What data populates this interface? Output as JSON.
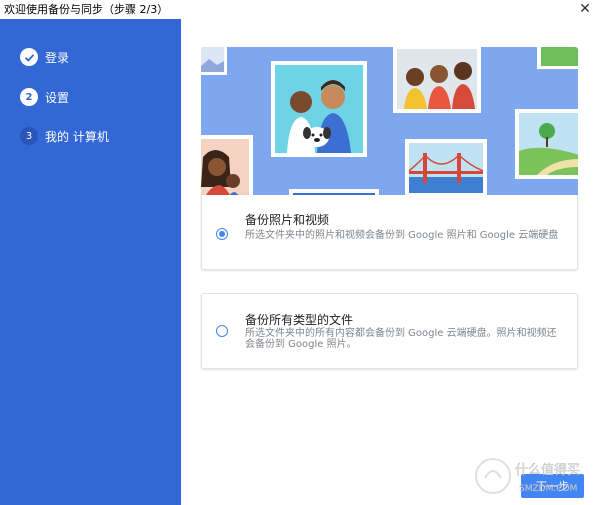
{
  "window": {
    "title": "欢迎使用备份与同步（步骤 2/3）",
    "close_icon": "close-icon"
  },
  "sidebar": {
    "steps": [
      {
        "number": "",
        "label": "登录",
        "state": "done",
        "icon": "check-icon"
      },
      {
        "number": "2",
        "label": "设置",
        "state": "current"
      },
      {
        "number": "3",
        "label": "我的 计算机",
        "state": "pending"
      }
    ]
  },
  "options": [
    {
      "title": "备份照片和视频",
      "description": "所选文件夹中的照片和视频会备份到 Google 照片和 Google 云端硬盘",
      "selected": true
    },
    {
      "title": "备份所有类型的文件",
      "description": "所选文件夹中的所有内容都会备份到 Google 云端硬盘。照片和视频还会备份到 Google 照片。",
      "selected": false
    }
  ],
  "footer": {
    "next_label": "下一步"
  },
  "watermark": {
    "text": "什么值得买",
    "site": "SMZDM.COM"
  },
  "colors": {
    "sidebar": "#3367d6",
    "accent": "#4285f4",
    "hero_bg": "#7fa7f0"
  }
}
